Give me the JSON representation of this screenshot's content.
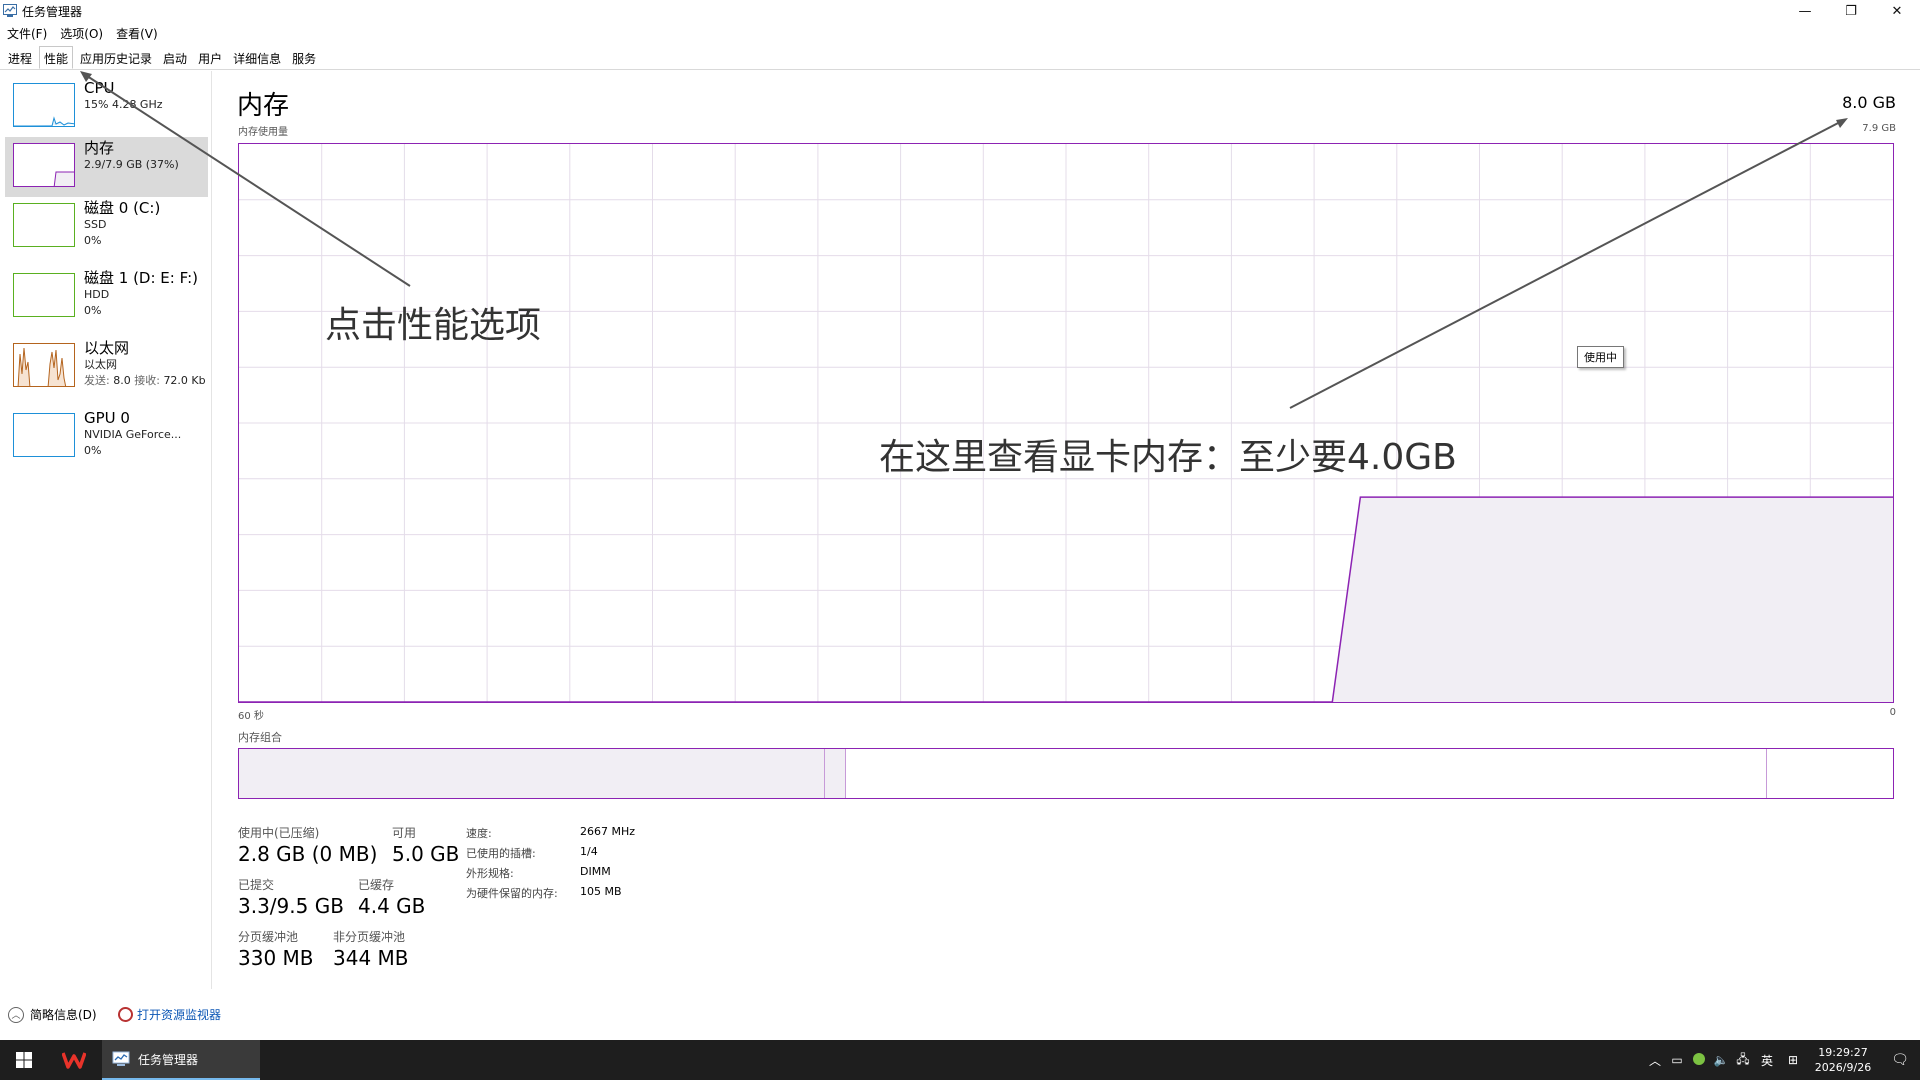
{
  "window": {
    "title": "任务管理器",
    "minimize": "—",
    "restore": "❐",
    "close": "✕"
  },
  "menu": [
    "文件(F)",
    "选项(O)",
    "查看(V)"
  ],
  "tabs": [
    "进程",
    "性能",
    "应用历史记录",
    "启动",
    "用户",
    "详细信息",
    "服务"
  ],
  "active_tab": "性能",
  "sidebar": [
    {
      "name": "CPU",
      "sub1": "15% 4.28 GHz",
      "sub2": "",
      "color": "#1e90d8"
    },
    {
      "name": "内存",
      "sub1": "2.9/7.9 GB (37%)",
      "sub2": "",
      "color": "#8c23b3"
    },
    {
      "name": "磁盘 0 (C:)",
      "sub1": "SSD",
      "sub2": "0%",
      "color": "#5ab020"
    },
    {
      "name": "磁盘 1 (D: E: F:)",
      "sub1": "HDD",
      "sub2": "0%",
      "color": "#5ab020"
    },
    {
      "name": "以太网",
      "sub1": "以太网",
      "sub2_key": "发送:",
      "sub2_val": "8.0",
      "sub2_key2": "接收:",
      "sub2_val2": "72.0 Kb",
      "color": "#b4641e"
    },
    {
      "name": "GPU 0",
      "sub1": "NVIDIA GeForce...",
      "sub2": "0%",
      "color": "#1e90d8"
    }
  ],
  "panel": {
    "title": "内存",
    "total": "8.0 GB",
    "chart_label": "内存使用量",
    "chart_max": "7.9 GB",
    "axis_left": "60 秒",
    "axis_right": "0",
    "tooltip": "使用中",
    "composition_label": "内存组合",
    "accent": "#8c23b3",
    "fill": "#f1eef4"
  },
  "stats": {
    "in_use_label": "使用中(已压缩)",
    "in_use_value": "2.8 GB (0 MB)",
    "available_label": "可用",
    "available_value": "5.0 GB",
    "committed_label": "已提交",
    "committed_value": "3.3/9.5 GB",
    "cached_label": "已缓存",
    "cached_value": "4.4 GB",
    "paged_label": "分页缓冲池",
    "paged_value": "330 MB",
    "nonpaged_label": "非分页缓冲池",
    "nonpaged_value": "344 MB"
  },
  "specs": [
    {
      "k": "速度:",
      "v": "2667 MHz"
    },
    {
      "k": "已使用的插槽:",
      "v": "1/4"
    },
    {
      "k": "外形规格:",
      "v": "DIMM"
    },
    {
      "k": "为硬件保留的内存:",
      "v": "105 MB"
    }
  ],
  "annotations": {
    "click_tab": "点击性能选项",
    "check_memory": "在这里查看显卡内存：至少要4.0GB"
  },
  "footer": {
    "fewer_details": "简略信息(D)",
    "open_resmon": "打开资源监视器"
  },
  "taskbar": {
    "task_label": "任务管理器",
    "ime": "英",
    "time": "19:29:27",
    "date": "2026/9/26"
  },
  "chart_data": {
    "type": "area",
    "title": "内存使用量",
    "x_range": [
      "60 秒",
      "0"
    ],
    "ylim": [
      0,
      7.9
    ],
    "unit": "GB",
    "series": [
      {
        "values": [
          0,
          0,
          0,
          0,
          0,
          0,
          0,
          0,
          0,
          0,
          0,
          0,
          0,
          0,
          0,
          0,
          0,
          0,
          0,
          0,
          0,
          0,
          0,
          0,
          0,
          0,
          0,
          0,
          0,
          0,
          0,
          0,
          0,
          0,
          0,
          0,
          0,
          0,
          0,
          0,
          2.9,
          2.9,
          2.9,
          2.9,
          2.9,
          2.9,
          2.9,
          2.9,
          2.9,
          2.9,
          2.9,
          2.9,
          2.9,
          2.9,
          2.9,
          2.9,
          2.9,
          2.9,
          2.9,
          2.9
        ]
      }
    ],
    "composition": {
      "in_use": 2.8,
      "modified": 0.1,
      "standby": 4.4,
      "free": 0.6,
      "total": 7.9
    }
  }
}
